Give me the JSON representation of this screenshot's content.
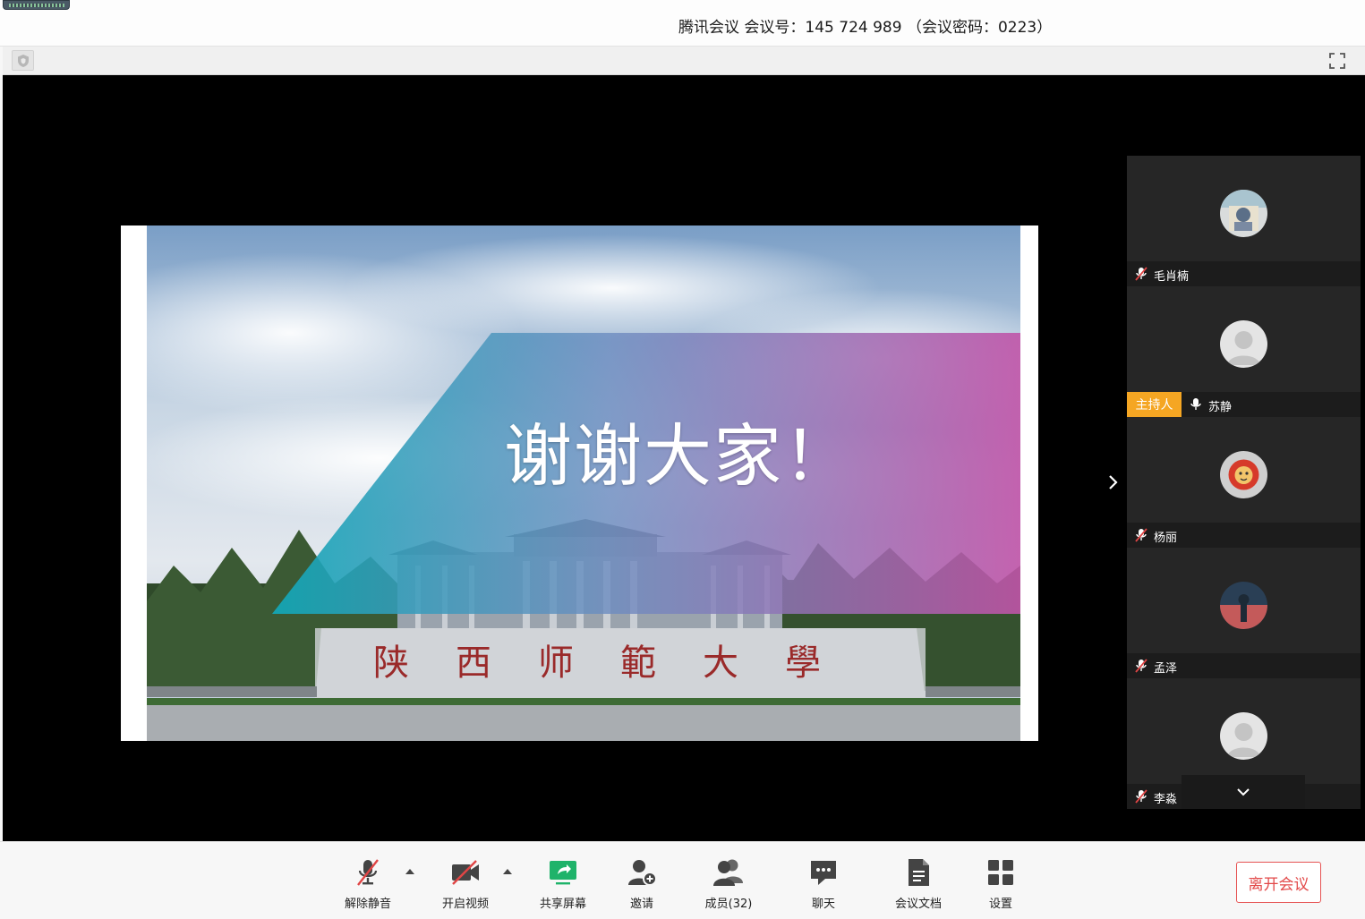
{
  "titlebar": {
    "title": "腾讯会议 会议号：145 724 989 （会议密码：0223）"
  },
  "slide": {
    "caption": "谢谢大家！",
    "sign_text": "陕西师範大學"
  },
  "gallery": {
    "participants": [
      {
        "name": "毛肖楠",
        "mic": "muted",
        "avatar": "photo-avatar",
        "host": false
      },
      {
        "name": "苏静",
        "mic": "on",
        "avatar": "default-avatar",
        "host": true
      },
      {
        "name": "杨丽",
        "mic": "muted",
        "avatar": "lion-avatar",
        "host": false
      },
      {
        "name": "孟泽",
        "mic": "muted",
        "avatar": "photo-avatar",
        "host": false
      },
      {
        "name": "李淼",
        "mic": "muted",
        "avatar": "default-avatar",
        "host": false
      }
    ],
    "host_label": "主持人"
  },
  "toolbar": {
    "unmute": "解除静音",
    "start_video": "开启视频",
    "share_screen": "共享屏幕",
    "invite": "邀请",
    "members": "成员(32)",
    "chat": "聊天",
    "docs": "会议文档",
    "settings": "设置",
    "leave": "离开会议"
  },
  "colors": {
    "host_badge": "#f5a623",
    "leave_red": "#e24848",
    "share_green": "#1fb36a",
    "mute_red": "#e04545"
  }
}
